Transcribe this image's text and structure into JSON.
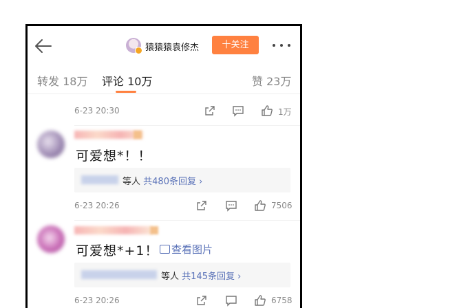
{
  "header": {
    "nickname": "猿猿猿袁修杰",
    "follow_label": "十关注"
  },
  "tabs": {
    "repost": "转发 18万",
    "comments": "评论 10万",
    "likes": "赞 23万"
  },
  "thread": {
    "first_meta": {
      "time": "6-23 20:30",
      "like_count": "1万"
    },
    "comments": [
      {
        "text": "可爱想*！！",
        "reply_suffix": "等人",
        "reply_total": "共480条回复 ›",
        "time": "6-23 20:26",
        "like_count": "7506"
      },
      {
        "text": "可爱想*+1！",
        "view_pic_label": "查看图片",
        "reply_suffix": "等人",
        "reply_total": "共145条回复 ›",
        "time": "6-23 20:26",
        "like_count": "6758"
      }
    ]
  },
  "colors": {
    "accent": "#ff8140",
    "link": "#5a72b8"
  },
  "icons": [
    "back-arrow-icon",
    "more-icon",
    "share-icon",
    "comment-icon",
    "thumbs-up-icon",
    "image-icon"
  ]
}
